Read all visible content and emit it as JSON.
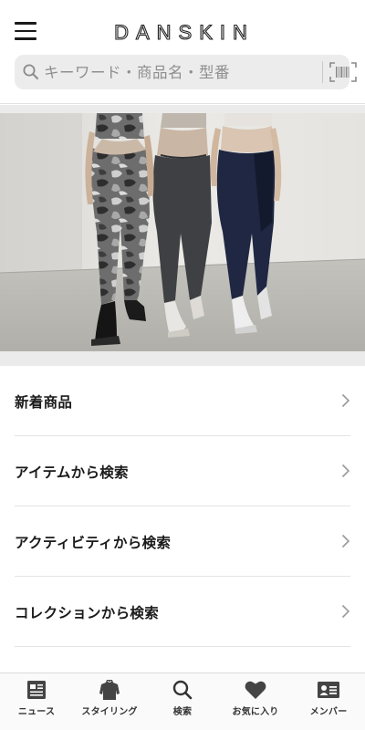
{
  "header": {
    "logo_text": "DANSKIN",
    "search": {
      "placeholder": "キーワード・商品名・型番"
    }
  },
  "hero": {
    "leggings": [
      "camouflage",
      "charcoal",
      "navy"
    ]
  },
  "menu": {
    "items": [
      {
        "label": "新着商品"
      },
      {
        "label": "アイテムから検索"
      },
      {
        "label": "アクティビティから検索"
      },
      {
        "label": "コレクションから検索"
      }
    ]
  },
  "tabbar": {
    "items": [
      {
        "label": "ニュース",
        "icon": "news-icon"
      },
      {
        "label": "スタイリング",
        "icon": "styling-icon"
      },
      {
        "label": "検索",
        "icon": "search-icon"
      },
      {
        "label": "お気に入り",
        "icon": "heart-icon"
      },
      {
        "label": "メンバー",
        "icon": "member-card-icon"
      }
    ]
  },
  "colors": {
    "text": "#1a1a1a",
    "icon": "#444444",
    "search_bg": "#ececec",
    "band": "#ebebeb",
    "chevron": "#9a9a9a"
  }
}
